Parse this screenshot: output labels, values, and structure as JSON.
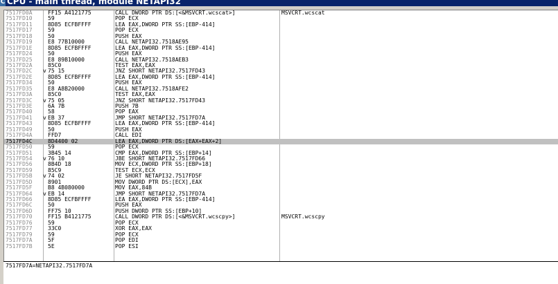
{
  "window": {
    "title": "CPU - main thread, module NETAPI32",
    "icon": "C"
  },
  "disasm": {
    "selected_index": 22,
    "rows": [
      {
        "addr": "7517FD0A",
        "mark": "",
        "hex": "FF15 A4121775",
        "asm": "CALL DWORD PTR DS:[<&MSVCRT.wcscat>]",
        "comment": "MSVCRT.wcscat"
      },
      {
        "addr": "7517FD10",
        "mark": "",
        "hex": "59",
        "asm": "POP ECX",
        "comment": ""
      },
      {
        "addr": "7517FD11",
        "mark": "",
        "hex": "8D85 ECFBFFFF",
        "asm": "LEA EAX,DWORD PTR SS:[EBP-414]",
        "comment": ""
      },
      {
        "addr": "7517FD17",
        "mark": "",
        "hex": "59",
        "asm": "POP ECX",
        "comment": ""
      },
      {
        "addr": "7517FD18",
        "mark": "",
        "hex": "50",
        "asm": "PUSH EAX",
        "comment": ""
      },
      {
        "addr": "7517FD19",
        "mark": "",
        "hex": "E8 77B10000",
        "asm": "CALL NETAPI32.7518AE95",
        "comment": ""
      },
      {
        "addr": "7517FD1E",
        "mark": "",
        "hex": "8D85 ECFBFFFF",
        "asm": "LEA EAX,DWORD PTR SS:[EBP-414]",
        "comment": ""
      },
      {
        "addr": "7517FD24",
        "mark": "",
        "hex": "50",
        "asm": "PUSH EAX",
        "comment": ""
      },
      {
        "addr": "7517FD25",
        "mark": "",
        "hex": "E8 89B10000",
        "asm": "CALL NETAPI32.7518AEB3",
        "comment": ""
      },
      {
        "addr": "7517FD2A",
        "mark": "",
        "hex": "85C0",
        "asm": "TEST EAX,EAX",
        "comment": ""
      },
      {
        "addr": "7517FD2C",
        "mark": "v",
        "hex": "75 15",
        "asm": "JNZ SHORT NETAPI32.7517FD43",
        "comment": ""
      },
      {
        "addr": "7517FD2E",
        "mark": "",
        "hex": "8D85 ECFBFFFF",
        "asm": "LEA EAX,DWORD PTR SS:[EBP-414]",
        "comment": ""
      },
      {
        "addr": "7517FD34",
        "mark": "",
        "hex": "50",
        "asm": "PUSH EAX",
        "comment": ""
      },
      {
        "addr": "7517FD35",
        "mark": "",
        "hex": "E8 A8B20000",
        "asm": "CALL NETAPI32.7518AFE2",
        "comment": ""
      },
      {
        "addr": "7517FD3A",
        "mark": "",
        "hex": "85C0",
        "asm": "TEST EAX,EAX",
        "comment": ""
      },
      {
        "addr": "7517FD3C",
        "mark": "v",
        "hex": "75 05",
        "asm": "JNZ SHORT NETAPI32.7517FD43",
        "comment": ""
      },
      {
        "addr": "7517FD3E",
        "mark": "",
        "hex": "6A 7B",
        "asm": "PUSH 7B",
        "comment": ""
      },
      {
        "addr": "7517FD40",
        "mark": "",
        "hex": "58",
        "asm": "POP EAX",
        "comment": ""
      },
      {
        "addr": "7517FD41",
        "mark": "v",
        "hex": "EB 37",
        "asm": "JMP SHORT NETAPI32.7517FD7A",
        "comment": ""
      },
      {
        "addr": "7517FD43",
        "mark": "",
        "hex": "8D85 ECFBFFFF",
        "asm": "LEA EAX,DWORD PTR SS:[EBP-414]",
        "comment": ""
      },
      {
        "addr": "7517FD49",
        "mark": "",
        "hex": "50",
        "asm": "PUSH EAX",
        "comment": ""
      },
      {
        "addr": "7517FD4A",
        "mark": "",
        "hex": "FFD7",
        "asm": "CALL EDI",
        "comment": ""
      },
      {
        "addr": "7517FD4C",
        "mark": "",
        "hex": "8D4400 02",
        "asm": "LEA EAX,DWORD PTR DS:[EAX+EAX+2]",
        "comment": ""
      },
      {
        "addr": "7517FD50",
        "mark": "",
        "hex": "59",
        "asm": "POP ECX",
        "comment": ""
      },
      {
        "addr": "7517FD51",
        "mark": "",
        "hex": "3B45 14",
        "asm": "CMP EAX,DWORD PTR SS:[EBP+14]",
        "comment": ""
      },
      {
        "addr": "7517FD54",
        "mark": "v",
        "hex": "76 10",
        "asm": "JBE SHORT NETAPI32.7517FD66",
        "comment": ""
      },
      {
        "addr": "7517FD56",
        "mark": "",
        "hex": "8B4D 18",
        "asm": "MOV ECX,DWORD PTR SS:[EBP+18]",
        "comment": ""
      },
      {
        "addr": "7517FD59",
        "mark": "",
        "hex": "85C9",
        "asm": "TEST ECX,ECX",
        "comment": ""
      },
      {
        "addr": "7517FD5B",
        "mark": "v",
        "hex": "74 02",
        "asm": "JE SHORT NETAPI32.7517FD5F",
        "comment": ""
      },
      {
        "addr": "7517FD5D",
        "mark": "",
        "hex": "8901",
        "asm": "MOV DWORD PTR DS:[ECX],EAX",
        "comment": ""
      },
      {
        "addr": "7517FD5F",
        "mark": "",
        "hex": "B8 4B080000",
        "asm": "MOV EAX,84B",
        "comment": ""
      },
      {
        "addr": "7517FD64",
        "mark": "v",
        "hex": "EB 14",
        "asm": "JMP SHORT NETAPI32.7517FD7A",
        "comment": ""
      },
      {
        "addr": "7517FD66",
        "mark": "",
        "hex": "8D85 ECFBFFFF",
        "asm": "LEA EAX,DWORD PTR SS:[EBP-414]",
        "comment": ""
      },
      {
        "addr": "7517FD6C",
        "mark": "",
        "hex": "50",
        "asm": "PUSH EAX",
        "comment": ""
      },
      {
        "addr": "7517FD6D",
        "mark": "",
        "hex": "FF75 10",
        "asm": "PUSH DWORD PTR SS:[EBP+10]",
        "comment": ""
      },
      {
        "addr": "7517FD70",
        "mark": "",
        "hex": "FF15 B4121775",
        "asm": "CALL DWORD PTR DS:[<&MSVCRT.wcscpy>]",
        "comment": "MSVCRT.wcscpy"
      },
      {
        "addr": "7517FD76",
        "mark": "",
        "hex": "59",
        "asm": "POP ECX",
        "comment": ""
      },
      {
        "addr": "7517FD77",
        "mark": "",
        "hex": "33C0",
        "asm": "XOR EAX,EAX",
        "comment": ""
      },
      {
        "addr": "7517FD79",
        "mark": "",
        "hex": "59",
        "asm": "POP ECX",
        "comment": ""
      },
      {
        "addr": "7517FD7A",
        "mark": "",
        "hex": "5F",
        "asm": "POP EDI",
        "comment": ""
      },
      {
        "addr": "7517FD7B",
        "mark": "",
        "hex": "5E",
        "asm": "POP ESI",
        "comment": ""
      }
    ]
  },
  "info": {
    "text": "7517FD7A=NETAPI32.7517FD7A"
  },
  "colors": {
    "titlebar": "#0a246a",
    "selection": "#c0c0c0",
    "address_text": "#8a8a8a"
  }
}
